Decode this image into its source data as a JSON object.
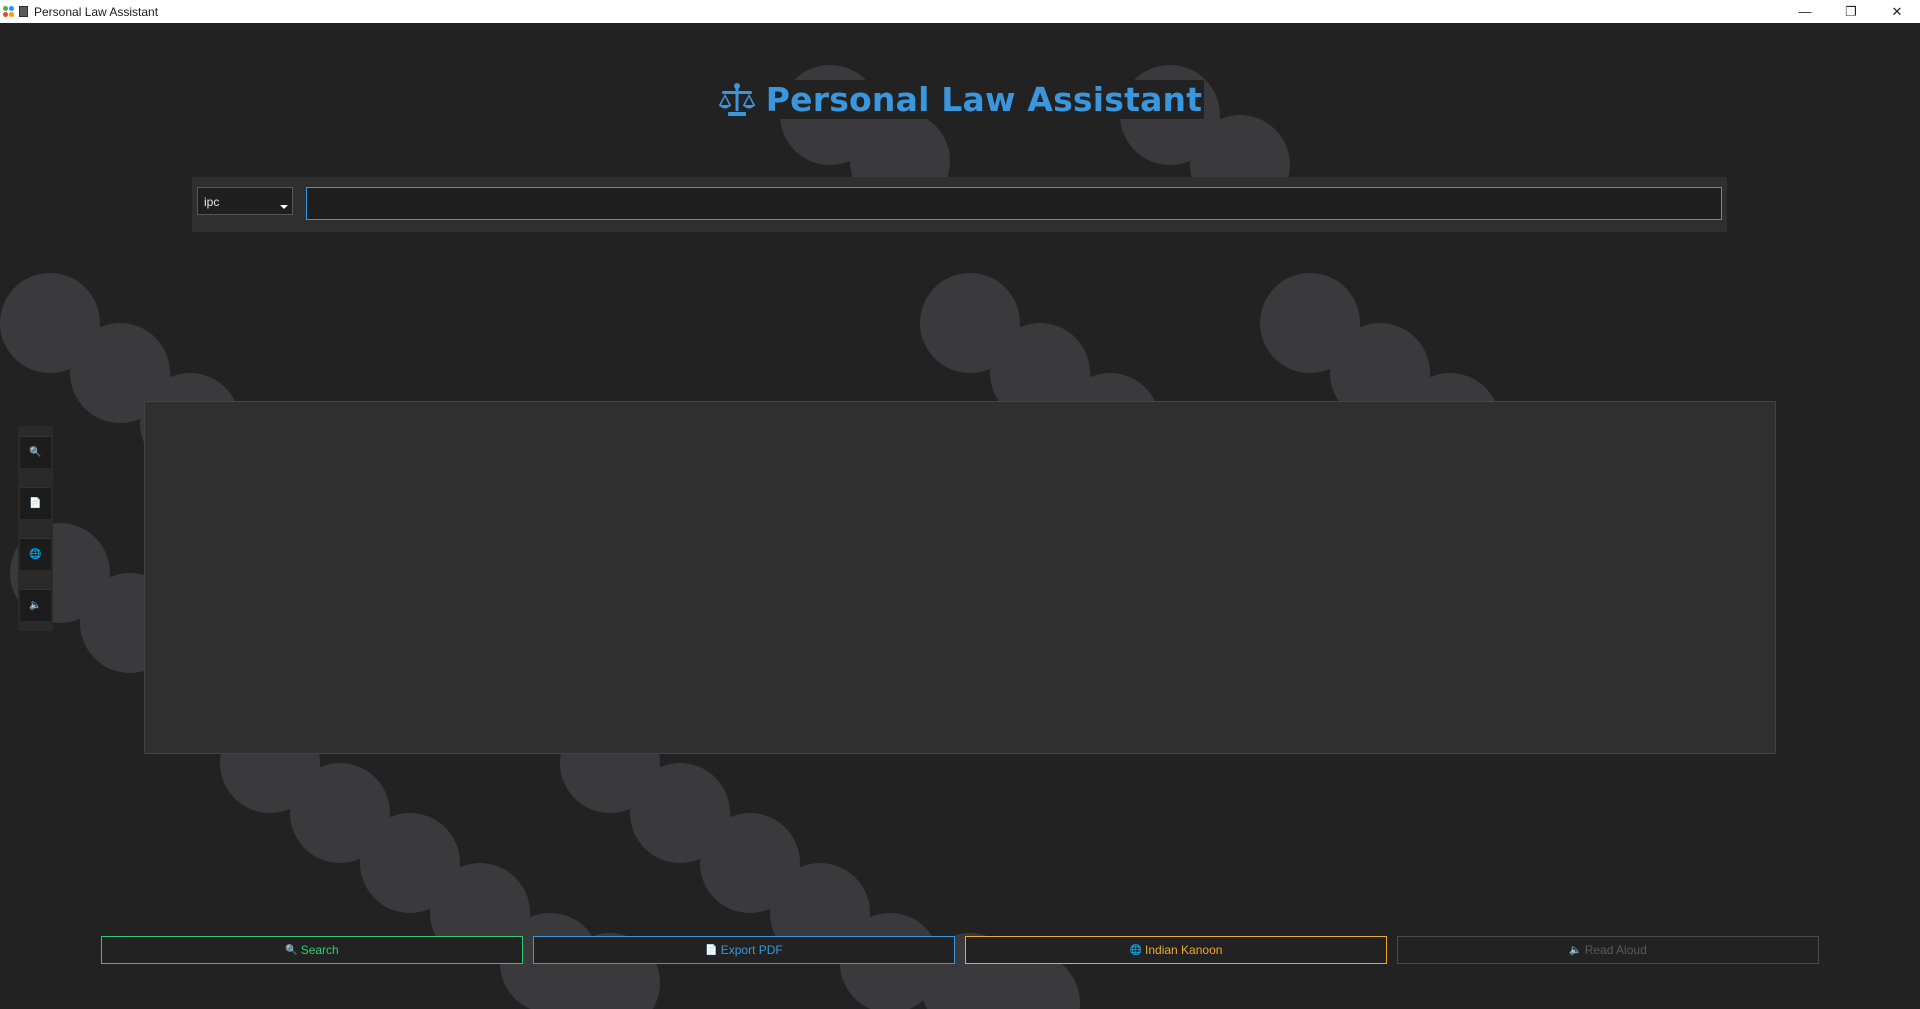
{
  "window": {
    "title": "Personal Law Assistant",
    "controls": {
      "minimize": "—",
      "restore": "❐",
      "close": "✕"
    }
  },
  "header": {
    "icon": "balance-scale-icon",
    "title": "Personal Law Assistant",
    "title_color": "#3a96dd"
  },
  "search": {
    "act_select": {
      "value": "ipc"
    },
    "query": {
      "value": "",
      "placeholder": ""
    }
  },
  "side_toolbar": {
    "items": [
      {
        "icon": "search-icon",
        "glyph": "🔍"
      },
      {
        "icon": "document-icon",
        "glyph": "📄"
      },
      {
        "icon": "globe-icon",
        "glyph": "🌐"
      },
      {
        "icon": "speaker-icon",
        "glyph": "🔈"
      }
    ]
  },
  "actions": {
    "search": {
      "label": "Search",
      "icon": "search-icon",
      "glyph": "🔍",
      "color": "#2ecc71"
    },
    "export_pdf": {
      "label": "Export PDF",
      "icon": "document-icon",
      "glyph": "📄",
      "color": "#3a96dd"
    },
    "indian_kanoon": {
      "label": "Indian Kanoon",
      "icon": "globe-icon",
      "glyph": "🌐",
      "color": "#f0a830"
    },
    "read_aloud": {
      "label": "Read Aloud",
      "icon": "speaker-icon",
      "glyph": "🔈",
      "color": "#5a5a5a"
    }
  }
}
